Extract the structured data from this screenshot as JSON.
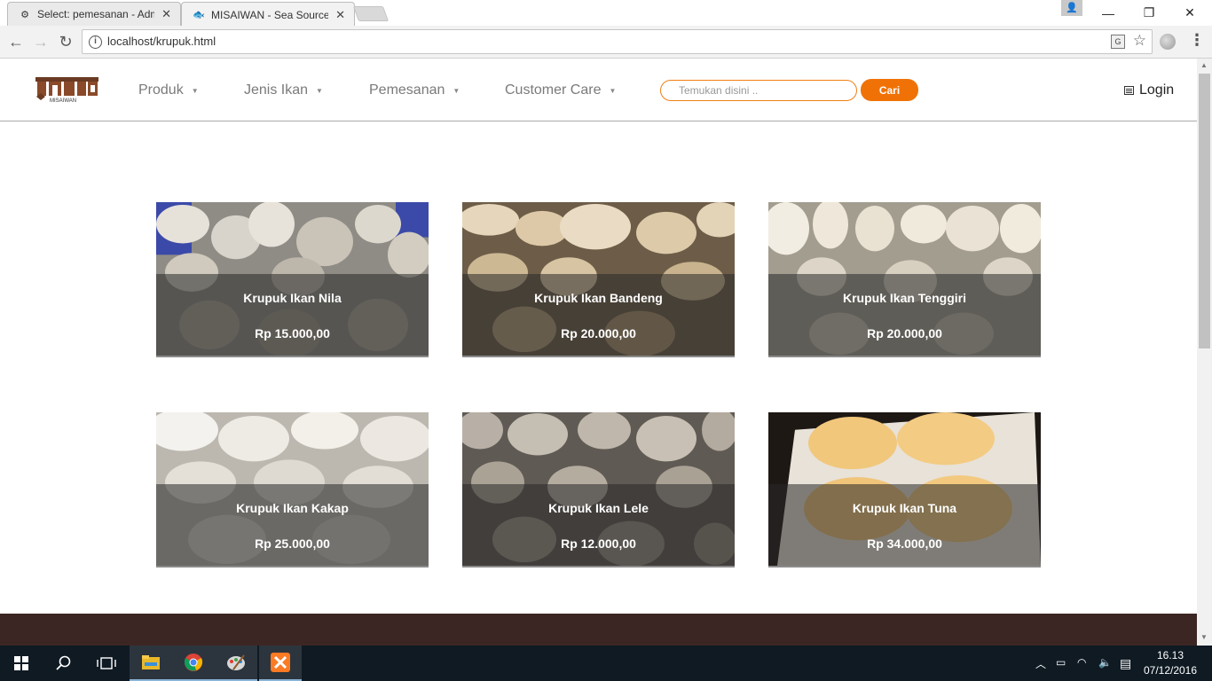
{
  "browser": {
    "tabs": [
      {
        "title": "Select: pemesanan - Adm",
        "active": false
      },
      {
        "title": "MISAIWAN - Sea Source",
        "active": true
      }
    ],
    "url": "localhost/krupuk.html"
  },
  "site": {
    "logo_text": "MISAIWAN",
    "nav": [
      {
        "label": "Produk"
      },
      {
        "label": "Jenis Ikan"
      },
      {
        "label": "Pemesanan"
      },
      {
        "label": "Customer Care"
      }
    ],
    "search": {
      "placeholder": "Temukan disini ..",
      "button": "Cari"
    },
    "login": "Login"
  },
  "products": [
    {
      "name": "Krupuk Ikan Nila",
      "price": "Rp 15.000,00"
    },
    {
      "name": "Krupuk Ikan Bandeng",
      "price": "Rp 20.000,00"
    },
    {
      "name": "Krupuk Ikan Tenggiri",
      "price": "Rp 20.000,00"
    },
    {
      "name": "Krupuk Ikan Kakap",
      "price": "Rp 25.000,00"
    },
    {
      "name": "Krupuk Ikan Lele",
      "price": "Rp 12.000,00"
    },
    {
      "name": "Krupuk Ikan Tuna",
      "price": "Rp 34.000,00"
    }
  ],
  "taskbar": {
    "time": "16.13",
    "date": "07/12/2016"
  },
  "colors": {
    "accent": "#f07206",
    "footer": "#3c2623"
  }
}
